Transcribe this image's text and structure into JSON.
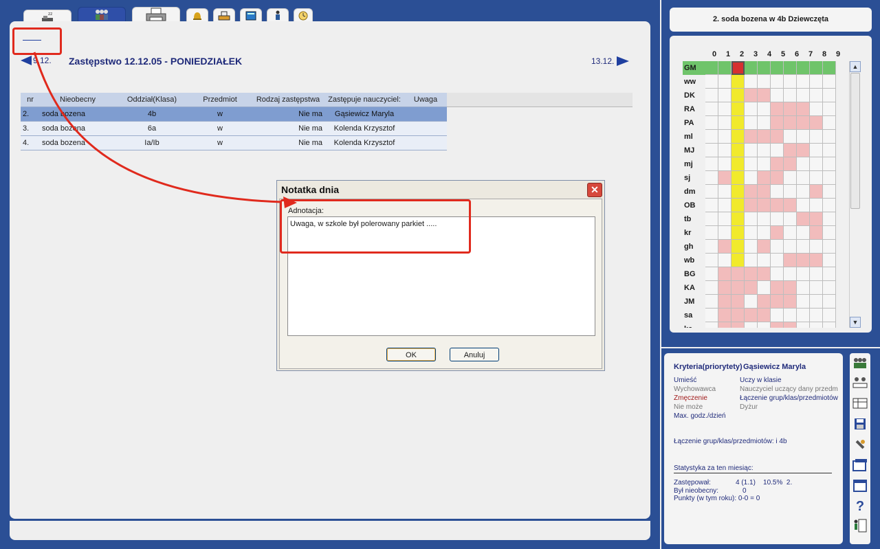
{
  "toolbar": {
    "tabs": [
      {
        "icon": "sleeping-icon"
      },
      {
        "icon": "teachers-icon"
      },
      {
        "icon": "printer-icon"
      },
      {
        "icon": "bell-icon"
      },
      {
        "icon": "desk-icon"
      },
      {
        "icon": "book-icon"
      },
      {
        "icon": "person-icon"
      },
      {
        "icon": "clock-icon"
      }
    ]
  },
  "nav": {
    "prev_date": "9.12.",
    "title": "Zastępstwo 12.12.05 - PONIEDZIAŁEK",
    "next_date": "13.12."
  },
  "table": {
    "headers": [
      "nr",
      "Nieobecny",
      "Oddział(Klasa)",
      "Przedmiot",
      "Rodzaj zastępstwa",
      "Zastępuje nauczyciel:",
      "Uwaga"
    ],
    "rows": [
      [
        "2.",
        "soda bozena",
        "4b",
        "w",
        "Nie ma",
        "Gąsiewicz Maryla",
        ""
      ],
      [
        "3.",
        "soda bozena",
        "6a",
        "w",
        "Nie ma",
        "Kolenda Krzysztof",
        ""
      ],
      [
        "4.",
        "soda bozena",
        "Ia/Ib",
        "w",
        "Nie ma",
        "Kolenda Krzysztof",
        ""
      ]
    ]
  },
  "dialog": {
    "title": "Notatka dnia",
    "label": "Adnotacja:",
    "text": "Uwaga, w szkole był polerowany parkiet .....",
    "ok": "OK",
    "cancel": "Anuluj"
  },
  "grid": {
    "title": "2. soda bozena w 4b Dziewczęta",
    "hours": [
      "0",
      "1",
      "2",
      "3",
      "4",
      "5",
      "6",
      "7",
      "8",
      "9"
    ],
    "rows": [
      {
        "name": "GM",
        "cells": "ggrgggggg"
      },
      {
        "name": "ww",
        "cells": "..y......"
      },
      {
        "name": "DK",
        "cells": "..ypp...."
      },
      {
        "name": "RA",
        "cells": "..y..ppp."
      },
      {
        "name": "PA",
        "cells": "..y..pppp"
      },
      {
        "name": "ml",
        "cells": "..yppp..."
      },
      {
        "name": "MJ",
        "cells": "..y...pp."
      },
      {
        "name": "mj",
        "cells": "..y..pp.."
      },
      {
        "name": "sj",
        "cells": ".py.pp..."
      },
      {
        "name": "dm",
        "cells": "..ypp...p"
      },
      {
        "name": "OB",
        "cells": "..ypppp.."
      },
      {
        "name": "tb",
        "cells": "..y....pp"
      },
      {
        "name": "kr",
        "cells": "..y..p..p"
      },
      {
        "name": "gh",
        "cells": ".py.p...."
      },
      {
        "name": "wb",
        "cells": "..y...ppp"
      },
      {
        "name": "BG",
        "cells": ".pppp...."
      },
      {
        "name": "KA",
        "cells": ".ppp.pp.."
      },
      {
        "name": "JM",
        "cells": ".pp.ppp.."
      },
      {
        "name": "sa",
        "cells": ".pppp...."
      },
      {
        "name": "ka",
        "cells": ".pp..pp.."
      }
    ]
  },
  "info": {
    "criteria_label": "Kryteria(priorytety)",
    "teacher": "Gąsiewicz Maryla",
    "left": [
      "Umieść",
      "Wychowawca",
      "Zmęczenie",
      "Nie może",
      "Max. godz./dzień"
    ],
    "right": [
      "Uczy w klasie",
      "Nauczyciel uczący dany przedm",
      "Łączenie grup/klas/przedmiotów",
      "Dyżur"
    ],
    "merge_line": "Łączenie grup/klas/przedmiotów:   i  4b",
    "stats_title": "Statystyka za ten miesiąc:",
    "stat1_label": "Zastępował:",
    "stat1_value": "4 (1.1)    10.5%  2.",
    "stat2_label": "Był nieobecny:",
    "stat2_value": "0",
    "stat3": "Punkty (w tym roku): 0-0 = 0"
  },
  "sidebar_icons": [
    "group-icon",
    "class-icon",
    "table-icon",
    "save-icon",
    "tools-icon",
    "window-icon",
    "frame-icon",
    "help-icon",
    "exit-icon"
  ]
}
